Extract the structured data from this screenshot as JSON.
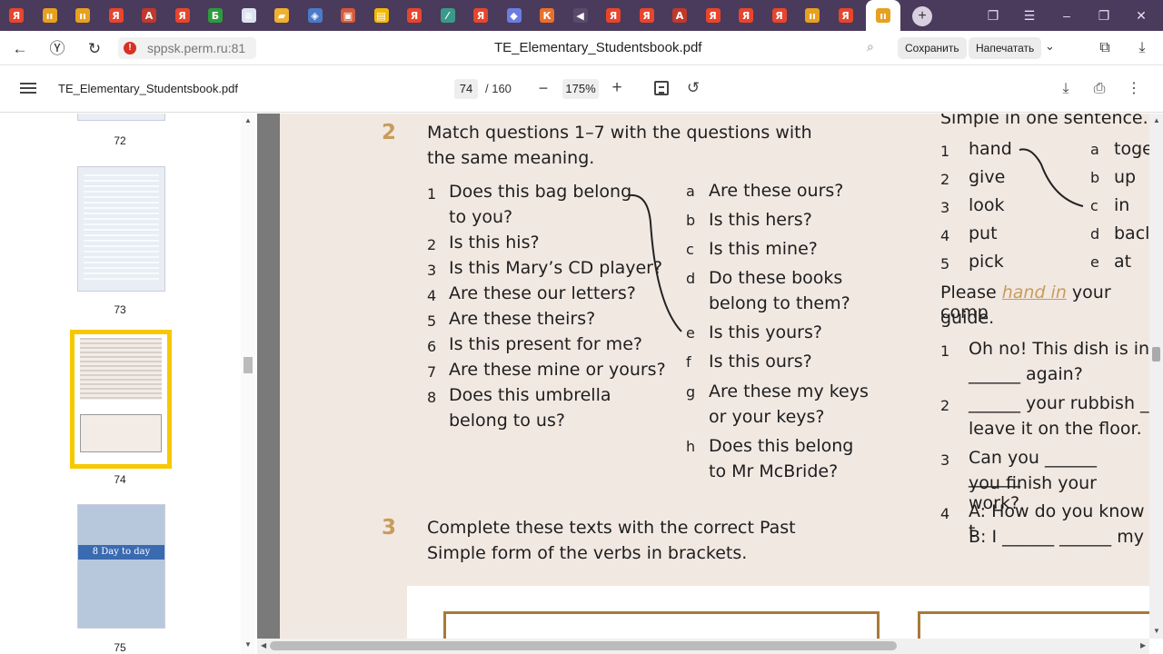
{
  "browser": {
    "tabs": [
      {
        "icon": "yandex-icon",
        "color": "#e8452c",
        "glyph": "Я"
      },
      {
        "icon": "ya-music-icon",
        "color": "#e8a020",
        "glyph": "ıı"
      },
      {
        "icon": "ya-music-icon",
        "color": "#e8a020",
        "glyph": "ıı"
      },
      {
        "icon": "yandex-icon",
        "color": "#e8452c",
        "glyph": "Я"
      },
      {
        "icon": "app-icon",
        "color": "#c0392b",
        "glyph": "A"
      },
      {
        "icon": "yandex-icon",
        "color": "#e8452c",
        "glyph": "Я"
      },
      {
        "icon": "b-icon",
        "color": "#2e9b3e",
        "glyph": "Б"
      },
      {
        "icon": "doc-icon",
        "color": "#dde3ee",
        "glyph": "≡"
      },
      {
        "icon": "folder-icon",
        "color": "#f0b030",
        "glyph": "▰"
      },
      {
        "icon": "shield-icon",
        "color": "#4a7ac8",
        "glyph": "◈"
      },
      {
        "icon": "image-icon",
        "color": "#d65a3a",
        "glyph": "▣"
      },
      {
        "icon": "slides-icon",
        "color": "#f2b705",
        "glyph": "▤"
      },
      {
        "icon": "yandex-icon",
        "color": "#e8452c",
        "glyph": "Я"
      },
      {
        "icon": "edit-icon",
        "color": "#3a9a8a",
        "glyph": "⁄"
      },
      {
        "icon": "yandex-icon",
        "color": "#e8452c",
        "glyph": "Я"
      },
      {
        "icon": "cube-icon",
        "color": "#6b7ee0",
        "glyph": "◆"
      },
      {
        "icon": "k-icon",
        "color": "#e8702c",
        "glyph": "К"
      },
      {
        "icon": "speaker-icon",
        "color": "#5a4a6c",
        "glyph": "◀"
      },
      {
        "icon": "yandex-icon",
        "color": "#e8452c",
        "glyph": "Я"
      },
      {
        "icon": "yandex-icon",
        "color": "#e8452c",
        "glyph": "Я"
      },
      {
        "icon": "app-icon",
        "color": "#c0392b",
        "glyph": "A"
      },
      {
        "icon": "yandex-icon",
        "color": "#e8452c",
        "glyph": "Я"
      },
      {
        "icon": "yandex-icon",
        "color": "#e8452c",
        "glyph": "Я"
      },
      {
        "icon": "yandex-icon",
        "color": "#e8452c",
        "glyph": "Я"
      },
      {
        "icon": "ya-music-icon",
        "color": "#e8a020",
        "glyph": "ıı"
      },
      {
        "icon": "yandex-icon",
        "color": "#e8452c",
        "glyph": "Я"
      }
    ],
    "active_tab": {
      "icon": "pdf-music-icon",
      "color": "#e8a020",
      "glyph": "ıı"
    },
    "new_tab": "+",
    "url": "sppsk.perm.ru:81",
    "title": "TE_Elementary_Studentsbook.pdf",
    "save_label": "Сохранить",
    "print_label": "Напечатать"
  },
  "pdf": {
    "filename": "TE_Elementary_Studentsbook.pdf",
    "current_page": "74",
    "total_pages": "/ 160",
    "zoom": "175%"
  },
  "thumbnails": [
    {
      "num": "72"
    },
    {
      "num": "73"
    },
    {
      "num": "74",
      "selected": true
    },
    {
      "num": "75",
      "caption": "8 Day to day"
    }
  ],
  "exercise2": {
    "num": "2",
    "instruction_1": "Match questions 1–7 with the questions with",
    "instruction_2": "the same meaning.",
    "questions": [
      {
        "n": "1",
        "l1": "Does this bag belong",
        "l2": "to you?"
      },
      {
        "n": "2",
        "l1": "Is this his?"
      },
      {
        "n": "3",
        "l1": "Is this Mary’s CD player?"
      },
      {
        "n": "4",
        "l1": "Are these our letters?"
      },
      {
        "n": "5",
        "l1": "Are these theirs?"
      },
      {
        "n": "6",
        "l1": "Is this present for me?"
      },
      {
        "n": "7",
        "l1": "Are these mine or yours?"
      },
      {
        "n": "8",
        "l1": "Does this umbrella",
        "l2": "belong to us?"
      }
    ],
    "answers": [
      {
        "n": "a",
        "l1": "Are these ours?"
      },
      {
        "n": "b",
        "l1": "Is this hers?"
      },
      {
        "n": "c",
        "l1": "Is this mine?"
      },
      {
        "n": "d",
        "l1": "Do these books",
        "l2": "belong to them?"
      },
      {
        "n": "e",
        "l1": "Is this yours?"
      },
      {
        "n": "f",
        "l1": "Is this ours?"
      },
      {
        "n": "g",
        "l1": "Are these my keys",
        "l2": "or your keys?"
      },
      {
        "n": "h",
        "l1": "Does this belong",
        "l2": "to Mr McBride?"
      }
    ]
  },
  "exercise3": {
    "num": "3",
    "line1": "Complete these texts with the correct Past",
    "line2": "Simple form of the verbs in brackets."
  },
  "right_column": {
    "header": "Simple in one sentence.",
    "verbs": [
      {
        "n": "1",
        "w": "hand",
        "l": "a",
        "p": "toge"
      },
      {
        "n": "2",
        "w": "give",
        "l": "b",
        "p": "up"
      },
      {
        "n": "3",
        "w": "look",
        "l": "c",
        "p": "in"
      },
      {
        "n": "4",
        "w": "put",
        "l": "d",
        "p": "bacl"
      },
      {
        "n": "5",
        "w": "pick",
        "l": "e",
        "p": "at"
      }
    ],
    "please_1": "Please",
    "please_link": "hand in",
    "please_2": "your comp",
    "guide": "guide.",
    "items": [
      {
        "n": "1",
        "l1": "Oh no! This dish is in",
        "l2": "______ again?"
      },
      {
        "n": "2",
        "l1": "______ your rubbish _",
        "l2": "leave it on the floor."
      },
      {
        "n": "3",
        "l1": "Can you ______ ______",
        "l2": "you finish your work?"
      },
      {
        "n": "4",
        "l1": "A: How do you know t",
        "l2": "B: I ______ ______ my"
      }
    ]
  }
}
